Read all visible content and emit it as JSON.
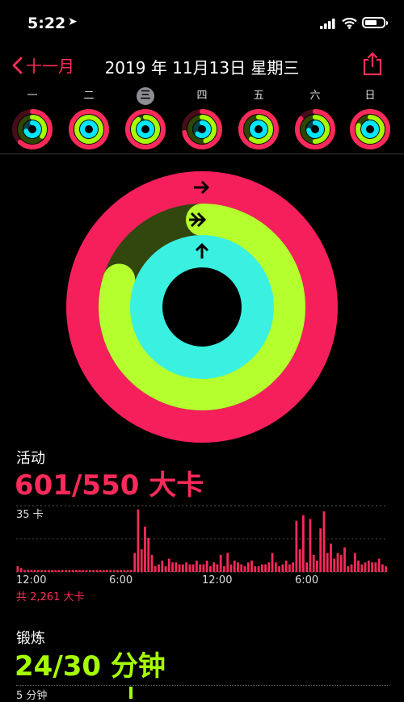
{
  "status_bar": {
    "time": "5:22"
  },
  "nav": {
    "back_label": "十一月",
    "title": "2019 年 11月13日 星期三"
  },
  "week": {
    "days": [
      "一",
      "二",
      "三",
      "四",
      "五",
      "六",
      "日"
    ],
    "selected_index": 2,
    "rings": [
      {
        "move": 0.62,
        "exercise": 0.35,
        "stand": 0.7
      },
      {
        "move": 1.0,
        "exercise": 1.0,
        "stand": 1.0
      },
      {
        "move": 1.0,
        "exercise": 0.9,
        "stand": 1.0
      },
      {
        "move": 0.72,
        "exercise": 0.45,
        "stand": 0.62
      },
      {
        "move": 1.0,
        "exercise": 0.6,
        "stand": 1.0
      },
      {
        "move": 0.85,
        "exercise": 0.5,
        "stand": 0.72
      },
      {
        "move": 1.0,
        "exercise": 0.8,
        "stand": 1.0
      }
    ]
  },
  "rings_today": {
    "move": 1.093,
    "exercise": 0.8,
    "stand": 1.08
  },
  "activity": {
    "label": "活动",
    "value": "601/550 大卡",
    "y_max_label": "35 卡",
    "x_labels": [
      "12:00",
      "6:00",
      "12:00",
      "6:00"
    ],
    "total": "共 2,261 大卡",
    "color": "#fa2a5a",
    "bars": [
      3,
      2,
      1,
      1,
      1,
      1,
      1,
      1,
      1,
      1,
      1,
      1,
      1,
      1,
      1,
      1,
      1,
      1,
      1,
      1,
      1,
      1,
      1,
      1,
      1,
      1,
      1,
      1,
      1,
      1,
      1,
      1,
      1,
      1,
      10,
      33,
      12,
      24,
      18,
      9,
      3,
      4,
      6,
      3,
      7,
      5,
      5,
      4,
      4,
      5,
      4,
      4,
      6,
      4,
      4,
      6,
      3,
      5,
      4,
      9,
      3,
      10,
      4,
      6,
      5,
      4,
      3,
      5,
      6,
      3,
      3,
      4,
      4,
      5,
      10,
      5,
      3,
      4,
      6,
      4,
      5,
      27,
      12,
      30,
      5,
      28,
      9,
      6,
      23,
      32,
      10,
      15,
      7,
      10,
      9,
      13,
      3,
      4,
      10,
      6,
      4,
      5,
      6,
      5,
      5,
      7,
      4,
      3
    ]
  },
  "exercise": {
    "label": "锻炼",
    "value": "24/30 分钟",
    "y_max_label": "5 分钟",
    "color": "#a6ff00"
  },
  "colors": {
    "move": "#fa2a5a",
    "exercise": "#a6ff00",
    "stand": "#00e6ff",
    "accent": "#ff2d55"
  }
}
